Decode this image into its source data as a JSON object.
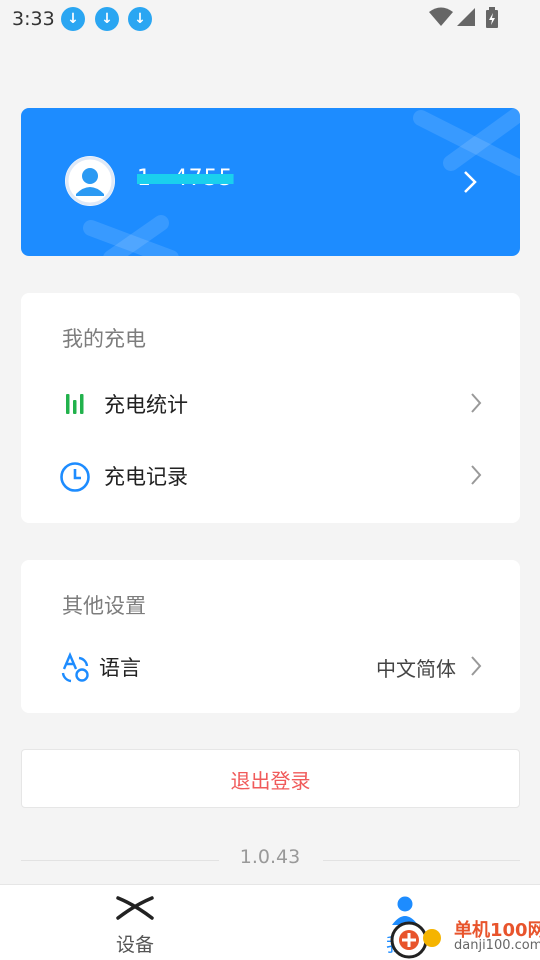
{
  "status_bar": {
    "time": "3:33",
    "download_icon": "↓"
  },
  "profile": {
    "account_name": "1    4755",
    "avatar_icon": "user-avatar-icon",
    "chevron_icon": "chevron-right-icon"
  },
  "my_charging": {
    "title": "我的充电",
    "items": [
      {
        "label": "充电统计",
        "icon": "bar-chart-icon",
        "icon_color": "#22b24c"
      },
      {
        "label": "充电记录",
        "icon": "clock-icon",
        "icon_color": "#1d8cff"
      }
    ]
  },
  "other_settings": {
    "title": "其他设置",
    "items": [
      {
        "label": "语言",
        "value": "中文简体",
        "icon": "language-icon",
        "icon_color": "#1d8cff"
      }
    ]
  },
  "logout_label": "退出登录",
  "version": "1.0.43",
  "bottom_nav": {
    "items": [
      {
        "label": "设备",
        "icon": "device-x-icon",
        "active": false
      },
      {
        "label": "我的",
        "icon": "person-icon",
        "active": true
      }
    ]
  },
  "watermark": {
    "title": "单机100网",
    "subtitle": "danji100.com"
  },
  "colors": {
    "accent": "#1d8cff",
    "danger": "#f05a5a",
    "background": "#f4f4f4"
  }
}
